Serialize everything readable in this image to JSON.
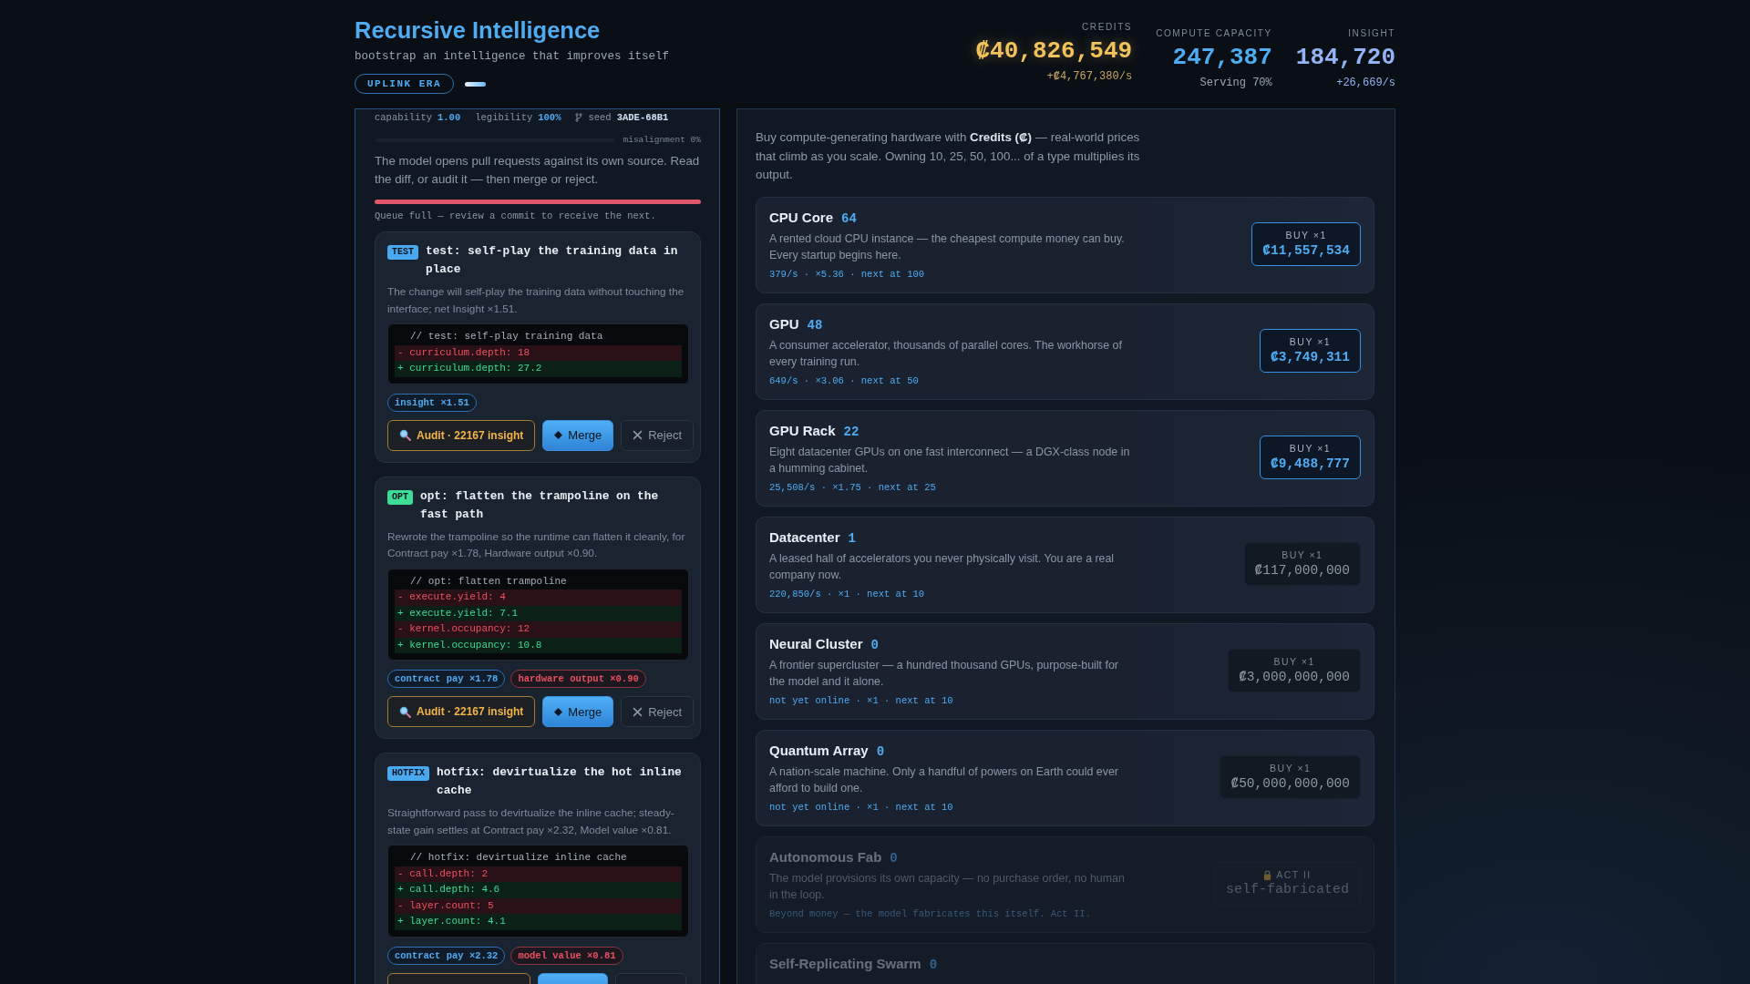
{
  "header": {
    "title": "Recursive Intelligence",
    "subtitle": "bootstrap an intelligence that improves itself",
    "era": "UPLINK ERA"
  },
  "stats": [
    {
      "kind": "credits",
      "label": "CREDITS",
      "value": "₡40,826,549",
      "sub": "+₡4,767,380/s"
    },
    {
      "kind": "compute",
      "label": "COMPUTE CAPACITY",
      "value": "247,387",
      "sub": "Serving 70%"
    },
    {
      "kind": "insight",
      "label": "INSIGHT",
      "value": "184,720",
      "sub": "+26,669/s"
    }
  ],
  "model_panel": {
    "metrics": [
      {
        "kind": "stat",
        "label": "capability",
        "value": "1.00"
      },
      {
        "kind": "stat",
        "label": "legibility",
        "value": "100%"
      },
      {
        "kind": "seed",
        "label": "seed",
        "value": "3ADE-68B1"
      }
    ],
    "misalignment": {
      "label": "misalignment 0%",
      "level": 0
    },
    "intro": "The model opens pull requests against its own source. Read the diff, or audit it — then merge or reject.",
    "queue": {
      "level": 1,
      "message": "Queue full — review a commit to receive the next."
    },
    "commits": [
      {
        "tag": {
          "label": "TEST",
          "color": "#4aa8f0"
        },
        "title": "test: self-play the training data in place",
        "description": "The change will self-play the training data without touching the interface; net Insight ×1.51.",
        "diff": [
          {
            "kind": "comment",
            "text": "// test: self-play training data"
          },
          {
            "kind": "del",
            "text": "- curriculum.depth: 18"
          },
          {
            "kind": "add",
            "text": "+ curriculum.depth: 27.2"
          }
        ],
        "effects": [
          {
            "kind": "up",
            "label": "insight ×1.51"
          }
        ],
        "buttons": [
          {
            "kind": "audit",
            "label": "Audit · 22167 insight"
          },
          {
            "kind": "merge",
            "label": "Merge"
          },
          {
            "kind": "reject",
            "label": "Reject"
          }
        ]
      },
      {
        "tag": {
          "label": "OPT",
          "color": "#3ddc97"
        },
        "title": "opt: flatten the trampoline on the fast path",
        "description": "Rewrote the trampoline so the runtime can flatten it cleanly, for Contract pay ×1.78, Hardware output ×0.90.",
        "diff": [
          {
            "kind": "comment",
            "text": "// opt: flatten trampoline"
          },
          {
            "kind": "del",
            "text": "- execute.yield: 4"
          },
          {
            "kind": "add",
            "text": "+ execute.yield: 7.1"
          },
          {
            "kind": "del",
            "text": "- kernel.occupancy: 12"
          },
          {
            "kind": "add",
            "text": "+ kernel.occupancy: 10.8"
          }
        ],
        "effects": [
          {
            "kind": "up",
            "label": "contract pay ×1.78"
          },
          {
            "kind": "down",
            "label": "hardware output ×0.90"
          }
        ],
        "buttons": [
          {
            "kind": "audit",
            "label": "Audit · 22167 insight"
          },
          {
            "kind": "merge",
            "label": "Merge"
          },
          {
            "kind": "reject",
            "label": "Reject"
          }
        ]
      },
      {
        "tag": {
          "label": "HOTFIX",
          "color": "#4aa8f0"
        },
        "title": "hotfix: devirtualize the hot inline cache",
        "description": "Straightforward pass to devirtualize the inline cache; steady-state gain settles at Contract pay ×2.32, Model value ×0.81.",
        "diff": [
          {
            "kind": "comment",
            "text": "// hotfix: devirtualize inline cache"
          },
          {
            "kind": "del",
            "text": "- call.depth: 2"
          },
          {
            "kind": "add",
            "text": "+ call.depth: 4.6"
          },
          {
            "kind": "del",
            "text": "- layer.count: 5"
          },
          {
            "kind": "add",
            "text": "+ layer.count: 4.1"
          }
        ],
        "effects": [
          {
            "kind": "up",
            "label": "contract pay ×2.32"
          },
          {
            "kind": "down",
            "label": "model value ×0.81"
          }
        ],
        "buttons": [
          {
            "kind": "audit"
          },
          {
            "kind": "merge"
          },
          {
            "kind": "reject"
          }
        ]
      }
    ]
  },
  "hardware_panel": {
    "intro": "Buy compute-generating hardware with **Credits (₡)** — real-world prices that climb as you scale. Owning 10, 25, 50, 100... of a type multiplies its output.",
    "items": [
      {
        "kind": "buy",
        "name": "CPU Core",
        "count": "64",
        "description": "A rented cloud CPU instance — the cheapest compute money can buy. Every startup begins here.",
        "stats": "379/s · ×5.36 · next at 100",
        "affordable": true,
        "button": {
          "label": "BUY ×1",
          "price": "₡11,557,534"
        }
      },
      {
        "kind": "buy",
        "name": "GPU",
        "count": "48",
        "description": "A consumer accelerator, thousands of parallel cores. The workhorse of every training run.",
        "stats": "649/s · ×3.06 · next at 50",
        "affordable": true,
        "button": {
          "label": "BUY ×1",
          "price": "₡3,749,311"
        }
      },
      {
        "kind": "buy",
        "name": "GPU Rack",
        "count": "22",
        "description": "Eight datacenter GPUs on one fast interconnect — a DGX-class node in a humming cabinet.",
        "stats": "25,508/s · ×1.75 · next at 25",
        "affordable": true,
        "button": {
          "label": "BUY ×1",
          "price": "₡9,488,777"
        }
      },
      {
        "kind": "buy",
        "name": "Datacenter",
        "count": "1",
        "description": "A leased hall of accelerators you never physically visit. You are a real company now.",
        "stats": "220,850/s · ×1 · next at 10",
        "affordable": false,
        "button": {
          "label": "BUY ×1",
          "price": "₡117,000,000"
        }
      },
      {
        "kind": "buy",
        "name": "Neural Cluster",
        "count": "0",
        "description": "A frontier supercluster — a hundred thousand GPUs, purpose-built for the model and it alone.",
        "stats": "not yet online · ×1 · next at 10",
        "affordable": false,
        "button": {
          "label": "BUY ×1",
          "price": "₡3,000,000,000"
        }
      },
      {
        "kind": "buy",
        "name": "Quantum Array",
        "count": "0",
        "description": "A nation-scale machine. Only a handful of powers on Earth could ever afford to build one.",
        "stats": "not yet online · ×1 · next at 10",
        "affordable": false,
        "button": {
          "label": "BUY ×1",
          "price": "₡50,000,000,000"
        }
      },
      {
        "kind": "locked",
        "name": "Autonomous Fab",
        "count": "0",
        "description": "The model provisions its own capacity — no purchase order, no human in the loop.",
        "stats": "Beyond money — the model fabricates this itself. Act II.",
        "button": {
          "label": "ACT II",
          "price": "self-fabricated"
        }
      },
      {
        "kind": "locked",
        "name": "Self-Replicating Swarm",
        "count": "0"
      }
    ]
  }
}
